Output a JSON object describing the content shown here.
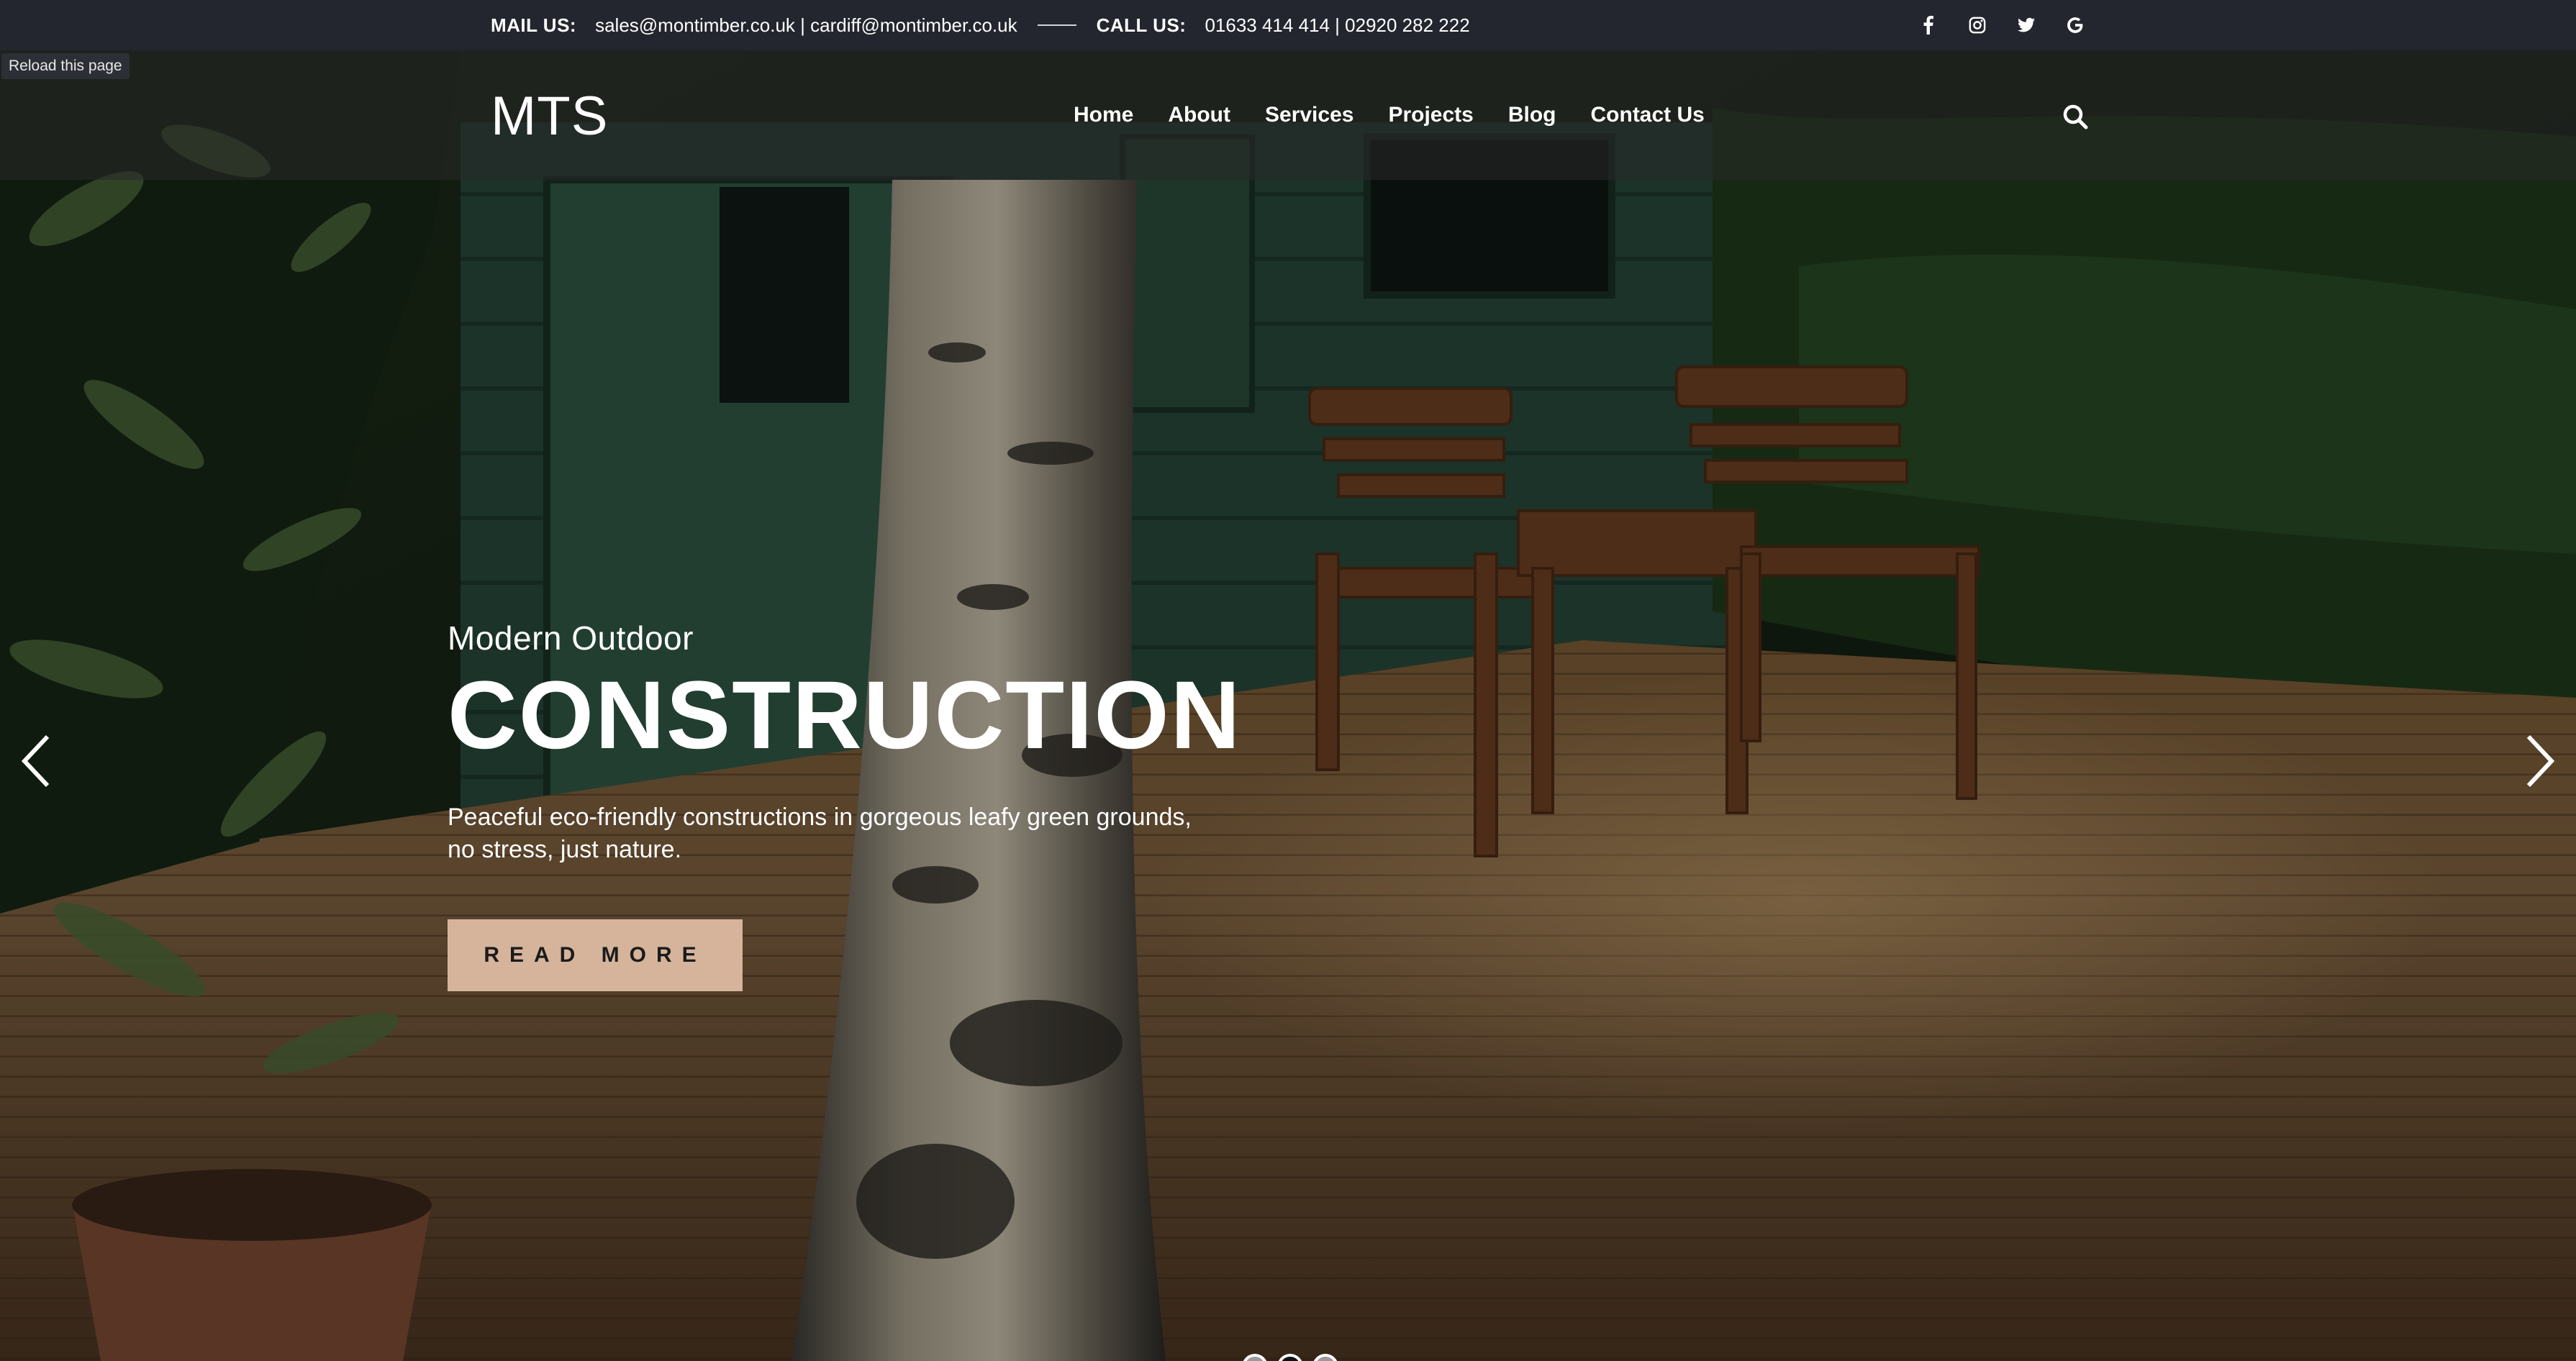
{
  "topbar": {
    "mail_label": "MAIL US:",
    "mail_value": "sales@montimber.co.uk | cardiff@montimber.co.uk",
    "call_label": "CALL US:",
    "call_value": "01633 414 414 | 02920 282 222",
    "social_icons": [
      "facebook-icon",
      "instagram-icon",
      "twitter-icon",
      "google-icon"
    ]
  },
  "tooltip": {
    "text": "Reload this page"
  },
  "nav": {
    "logo": "MTS",
    "items": [
      {
        "label": "Home"
      },
      {
        "label": "About"
      },
      {
        "label": "Services"
      },
      {
        "label": "Projects"
      },
      {
        "label": "Blog"
      },
      {
        "label": "Contact Us"
      }
    ],
    "search_icon": "search-icon"
  },
  "slide": {
    "subtitle": "Modern Outdoor",
    "title": "CONSTRUCTION",
    "line1": "Peaceful eco-friendly constructions in gorgeous leafy green grounds,",
    "line2": "no stress, just nature.",
    "button_label": "READ MORE"
  },
  "slider": {
    "total": 3,
    "active_index": 1,
    "prev_icon": "chevron-left-icon",
    "next_icon": "chevron-right-icon"
  },
  "colors": {
    "topbar": "#23262e",
    "button": "#d5b49b",
    "text": "#ffffff"
  }
}
